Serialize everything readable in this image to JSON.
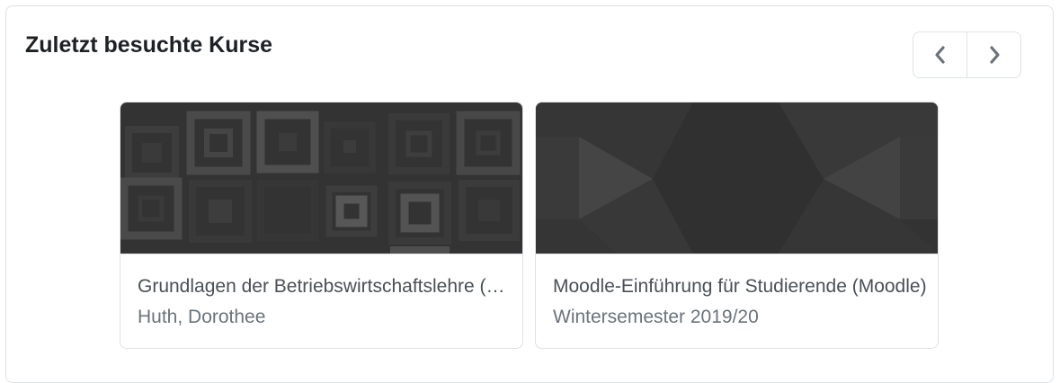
{
  "block": {
    "title": "Zuletzt besuchte Kurse"
  },
  "navigation": {
    "previous_icon": "chevron-left-icon",
    "next_icon": "chevron-right-icon"
  },
  "courses": [
    {
      "title": "Grundlagen der Betriebswirtschaftslehre (BWL)",
      "subtitle": "Huth, Dorothee",
      "image_pattern": "squares"
    },
    {
      "title": "Moodle-Einführung für Studierende (Moodle)",
      "subtitle": "Wintersemester 2019/20",
      "image_pattern": "triangles"
    }
  ],
  "colors": {
    "title_text": "#1d2125",
    "card_text": "#495057",
    "muted_text": "#6a737b",
    "border": "#dee2e6",
    "image_dark": "#333333"
  }
}
